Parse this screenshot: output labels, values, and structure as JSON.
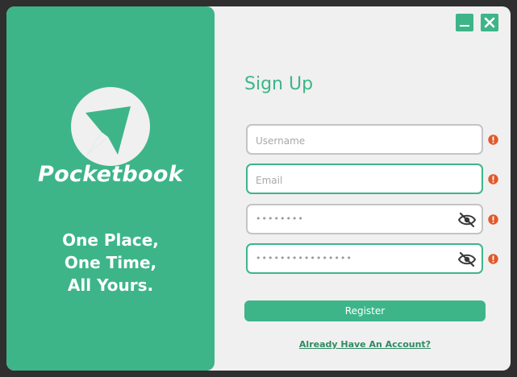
{
  "brand": {
    "name": "Pocketbook",
    "tagline_lines": [
      "One Place,",
      "One Time,",
      "All Yours."
    ]
  },
  "window_controls": {
    "minimize_icon": "minimize-icon",
    "close_icon": "close-icon"
  },
  "form": {
    "title": "Sign Up",
    "username": {
      "placeholder": "Username",
      "value": ""
    },
    "email": {
      "placeholder": "Email",
      "value": ""
    },
    "password": {
      "masked": "••••••••"
    },
    "confirm_password": {
      "masked": "••••••••••••••••"
    },
    "register_label": "Register",
    "login_link": "Already Have An Account?"
  },
  "colors": {
    "accent": "#3db589",
    "warning": "#e05a2b",
    "background": "#f0f0f0"
  }
}
